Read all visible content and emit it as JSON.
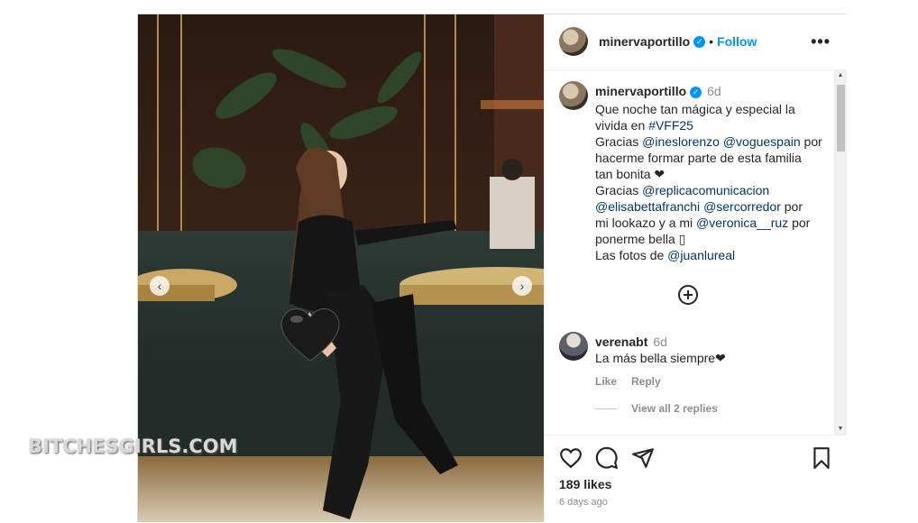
{
  "post": {
    "username": "minervaportillo",
    "verified_mark": "✓",
    "separator": "•",
    "follow_label": "Follow",
    "more_label": "•••"
  },
  "caption": {
    "username": "minervaportillo",
    "time": "6d",
    "lines": [
      [
        "Que noche tan mágica y especial la"
      ],
      [
        "vivida en ",
        "#VFF25"
      ],
      [
        "Gracias ",
        "@ineslorenzo",
        " ",
        "@voguespain",
        " por"
      ],
      [
        "hacerme formar parte de esta familia"
      ],
      [
        "tan bonita ❤"
      ],
      [
        "Gracias ",
        "@replicacomunicacion"
      ],
      [
        "@elisabettafranchi",
        " ",
        "@sercorredor",
        " por"
      ],
      [
        "mi lookazo y a mi ",
        "@veronica__ruz",
        " por"
      ],
      [
        "ponerme bella ▯"
      ],
      [
        "Las fotos de ",
        "@juanlureal"
      ]
    ]
  },
  "comment": {
    "username": "verenabt",
    "time": "6d",
    "text": "La más bella siempre❤",
    "like_label": "Like",
    "reply_label": "Reply",
    "view_replies": "View all 2 replies"
  },
  "stats": {
    "likes": "189 likes",
    "ago": "6 days ago"
  },
  "watermark": "BITCHESGIRLS.COM",
  "icons": [
    "heart-icon",
    "comment-icon",
    "share-icon",
    "bookmark-icon",
    "add-comment-icon",
    "chevron-left-icon",
    "chevron-right-icon"
  ]
}
